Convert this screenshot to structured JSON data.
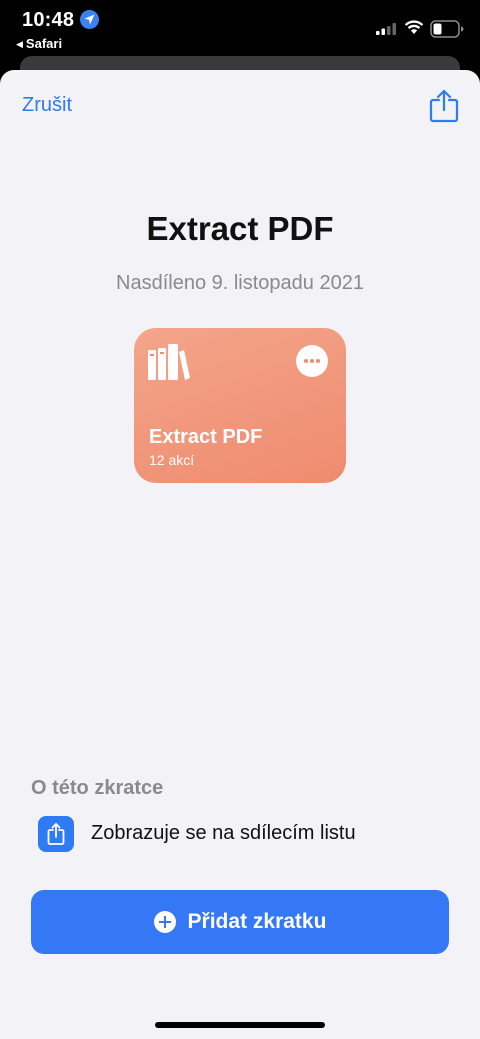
{
  "status_bar": {
    "time": "10:48",
    "back_app": "Safari",
    "icons": [
      "location-icon",
      "signal-icon",
      "wifi-icon",
      "battery-icon"
    ]
  },
  "header": {
    "cancel_label": "Zrušit",
    "share_icon": "share-icon"
  },
  "shortcut": {
    "title": "Extract PDF",
    "shared_date": "Nasdíleno 9. listopadu 2021",
    "card_title": "Extract PDF",
    "card_actions": "12 akcí",
    "card_icon": "books-icon",
    "card_color": "#ef8b6f"
  },
  "about": {
    "heading": "O této zkratce",
    "item_text": "Zobrazuje se na sdílecím listu",
    "item_icon": "share-sheet-icon"
  },
  "add_button": {
    "label": "Přidat zkratku",
    "color": "#3478f6"
  },
  "colors": {
    "accent": "#2f7bf2",
    "background": "#f2f2f7"
  }
}
